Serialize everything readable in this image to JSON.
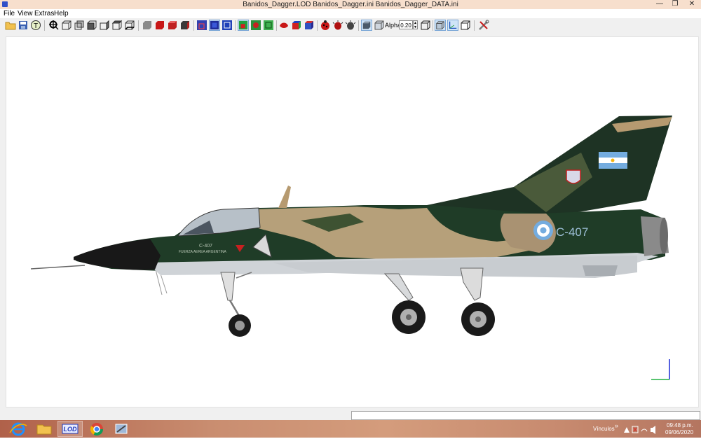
{
  "window": {
    "title": "Banidos_Dagger.LOD  Banidos_Dagger.ini  Banidos_Dagger_DATA.ini",
    "minimize": "—",
    "restore": "❐",
    "close": "✕"
  },
  "menu": [
    "File",
    "View",
    "Extras",
    "Help"
  ],
  "toolbar": {
    "alpha_label": "Alpha:",
    "alpha_value": "0.20",
    "icons": [
      "open-icon",
      "save-icon",
      "texture-icon",
      "zoom-fit-icon",
      "view-front-icon",
      "view-back-icon",
      "view-left-icon",
      "view-right-icon",
      "view-top-icon",
      "view-bottom-icon",
      "solid-gray-icon",
      "solid-red-icon",
      "shaded-red-icon",
      "dark-cube-icon",
      "bbox-red-icon",
      "bbox-blue-icon",
      "bbox-outline-icon",
      "bbox-green-icon",
      "green-sphere-icon",
      "green-wire-icon",
      "red-object-icon",
      "multicolor-cube-icon",
      "textured-cube-icon",
      "ladybug-icon",
      "bug-red-icon",
      "bug-gray-icon",
      "solid-box-icon",
      "transparent-box-icon",
      "wire-box-icon",
      "light-box-icon",
      "axes-icon",
      "page-box-icon",
      "tools-icon"
    ]
  },
  "model": {
    "serial": "C-407",
    "nose_serial": "C-407",
    "air_force_label": "FUERZA AEREA ARGENTINA"
  },
  "taskbar": {
    "apps": [
      "ie-icon",
      "explorer-icon",
      "lod-app-icon",
      "chrome-icon",
      "tool-app-icon"
    ],
    "lod_label": "LOD",
    "links_label": "Vínculos",
    "time": "09:48 p.m.",
    "date": "09/06/2020"
  }
}
